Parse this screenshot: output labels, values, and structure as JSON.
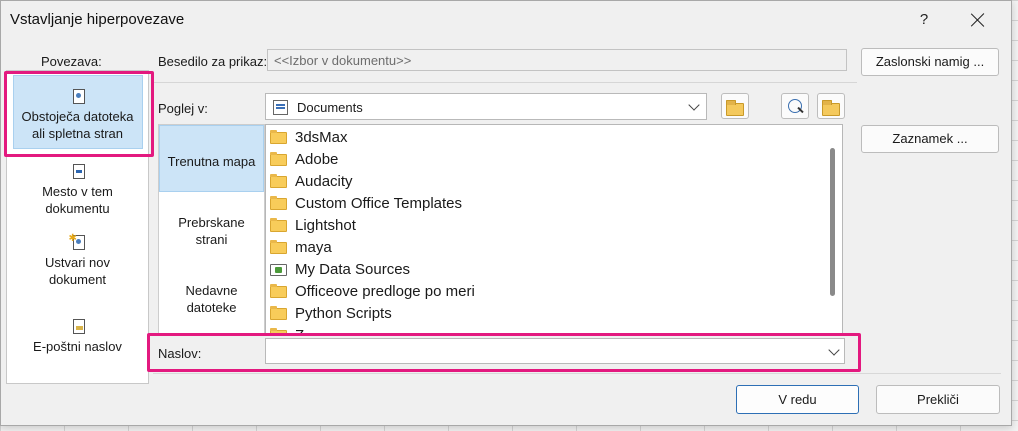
{
  "dialog": {
    "title": "Vstavljanje hiperpovezave",
    "help_glyph": "?"
  },
  "linkbar": {
    "label": "Povezava:",
    "items": [
      {
        "line1": "Obstoječa datoteka",
        "line2": "ali spletna stran",
        "icon": "existing-file-icon",
        "selected": true
      },
      {
        "line1": "Mesto v tem",
        "line2": "dokumentu",
        "icon": "place-in-document-icon"
      },
      {
        "line1": "Ustvari nov",
        "line2": "dokument",
        "icon": "new-document-icon"
      },
      {
        "line1": "E-poštni naslov",
        "line2": "",
        "icon": "email-icon"
      }
    ]
  },
  "text_to_display": {
    "label": "Besedilo za prikaz:",
    "value": "<<Izbor v dokumentu>>"
  },
  "screen_tip_button": "Zaslonski namig ...",
  "bookmark_button": "Zaznamek ...",
  "look_in": {
    "label": "Poglej v:",
    "value": "Documents"
  },
  "places": [
    {
      "line1": "Trenutna mapa",
      "line2": "",
      "selected": true
    },
    {
      "line1": "Prebrskane",
      "line2": "strani"
    },
    {
      "line1": "Nedavne",
      "line2": "datoteke"
    }
  ],
  "files": [
    {
      "name": "3dsMax",
      "type": "folder"
    },
    {
      "name": "Adobe",
      "type": "folder"
    },
    {
      "name": "Audacity",
      "type": "folder"
    },
    {
      "name": "Custom Office Templates",
      "type": "folder"
    },
    {
      "name": "Lightshot",
      "type": "folder"
    },
    {
      "name": "maya",
      "type": "folder"
    },
    {
      "name": "My Data Sources",
      "type": "data-source"
    },
    {
      "name": "Officeove predloge po meri",
      "type": "folder"
    },
    {
      "name": "Python Scripts",
      "type": "folder"
    },
    {
      "name": "Z",
      "type": "folder"
    }
  ],
  "address": {
    "label": "Naslov:",
    "value": ""
  },
  "ok_button": "V redu",
  "cancel_button": "Prekliči",
  "highlight_color": "#e3197f"
}
